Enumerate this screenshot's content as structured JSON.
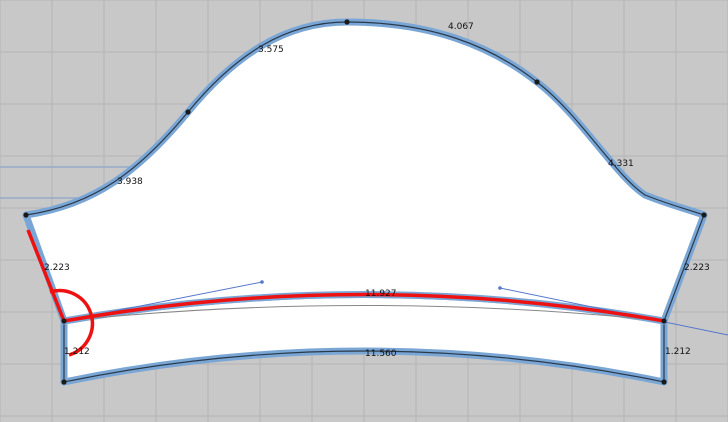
{
  "colors": {
    "background": "#c8c8c8",
    "grid": "#b4b4b4",
    "piece_fill": "#ffffff",
    "seam_highlight": "#7aa6d6",
    "seam_line": "#2a3a4a",
    "selection_red": "#ee1111",
    "guide_blue": "#5577cc"
  },
  "dimensions": {
    "cap_left_upper": "3.938",
    "cap_left_top": "3.575",
    "cap_right_top": "4.067",
    "cap_right_lower": "4.331",
    "side_left": "2.223",
    "side_right": "2.223",
    "seam_curve": "11.927",
    "cuff_left": "1.212",
    "cuff_right": "1.212",
    "cuff_bottom": "11.560"
  }
}
